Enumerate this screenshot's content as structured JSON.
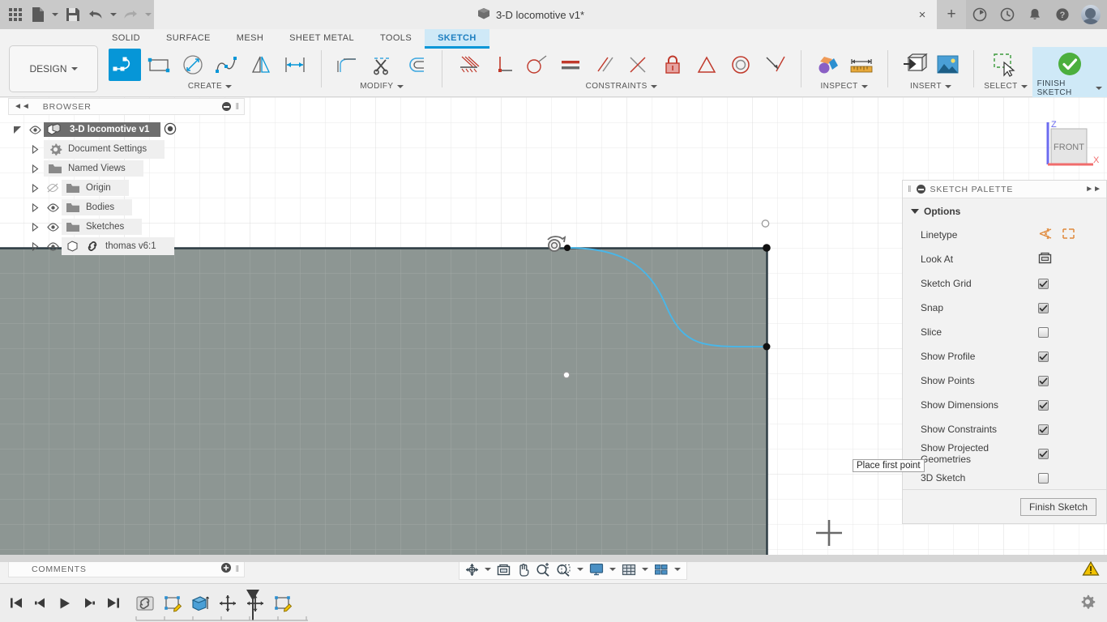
{
  "titlebar": {
    "app_grid_icon": "app-grid-icon",
    "new_label": "new-document-icon",
    "save_label": "save-icon",
    "undo_label": "undo-icon",
    "redo_label": "redo-icon",
    "document_title": "3-D locomotive v1*",
    "document_icon": "cube-icon",
    "close_label": "×",
    "plus_label": "+",
    "icons": [
      "job-status-icon",
      "recent-icon",
      "notifications-icon",
      "help-icon"
    ],
    "avatar": "user-avatar"
  },
  "ribbon": {
    "workspace_button": "DESIGN",
    "tabs": [
      {
        "label": "SOLID",
        "active": false
      },
      {
        "label": "SURFACE",
        "active": false
      },
      {
        "label": "MESH",
        "active": false
      },
      {
        "label": "SHEET METAL",
        "active": false
      },
      {
        "label": "TOOLS",
        "active": false
      },
      {
        "label": "SKETCH",
        "active": true
      }
    ],
    "panels": [
      {
        "label": "CREATE",
        "has_dropdown": true,
        "tools": [
          "line-tool",
          "rectangle-tool",
          "circle-tool",
          "spline-tool",
          "mirror-tool",
          "sketch-dimension-tool"
        ]
      },
      {
        "label": "MODIFY",
        "has_dropdown": true,
        "tools": [
          "fillet-tool",
          "trim-tool",
          "offset-tool"
        ]
      },
      {
        "label": "CONSTRAINTS",
        "has_dropdown": true,
        "tools": [
          "horizontal-vertical-constraint",
          "perpendicular-constraint",
          "tangent-constraint",
          "equal-constraint",
          "parallel-constraint",
          "coincident-constraint",
          "fix-unfix-constraint",
          "midpoint-constraint",
          "concentric-constraint",
          "collinear-constraint"
        ]
      },
      {
        "label": "INSPECT",
        "has_dropdown": true,
        "tools": [
          "interference-tool",
          "measure-tool"
        ]
      },
      {
        "label": "INSERT",
        "has_dropdown": true,
        "tools": [
          "insert-derive-tool",
          "insert-canvas-tool"
        ]
      },
      {
        "label": "SELECT",
        "has_dropdown": true,
        "tools": [
          "select-window-tool"
        ]
      },
      {
        "label": "FINISH SKETCH",
        "has_dropdown": true,
        "tools": [
          "finish-sketch-check"
        ]
      }
    ]
  },
  "browser": {
    "title": "BROWSER",
    "collapse_icon": "collapse-left-icon",
    "tree": [
      {
        "label": "3-D locomotive v1",
        "icon": "assembly-icon",
        "eye": true,
        "root": true,
        "expander": "open"
      },
      {
        "label": "Document Settings",
        "icon": "gear-icon",
        "eye": false,
        "expander": "closed"
      },
      {
        "label": "Named Views",
        "icon": "folder-icon",
        "eye": false,
        "expander": "closed"
      },
      {
        "label": "Origin",
        "icon": "folder-icon",
        "eye": "hidden",
        "expander": "closed"
      },
      {
        "label": "Bodies",
        "icon": "folder-icon",
        "eye": true,
        "expander": "closed"
      },
      {
        "label": "Sketches",
        "icon": "folder-icon",
        "eye": true,
        "expander": "closed"
      },
      {
        "label": "thomas v6:1",
        "icon": "component-linked-icon",
        "eye": true,
        "expander": "closed"
      }
    ]
  },
  "sketch_palette": {
    "title": "SKETCH PALETTE",
    "pin_icon": "collapse-right-icon",
    "section_label": "Options",
    "rows": [
      {
        "label": "Linetype",
        "type": "icons",
        "icons": [
          "construction-line-icon",
          "centerline-icon"
        ]
      },
      {
        "label": "Look At",
        "type": "icon",
        "icons": [
          "look-at-icon"
        ]
      },
      {
        "label": "Sketch Grid",
        "type": "checkbox",
        "checked": true
      },
      {
        "label": "Snap",
        "type": "checkbox",
        "checked": true
      },
      {
        "label": "Slice",
        "type": "checkbox",
        "checked": false
      },
      {
        "label": "Show Profile",
        "type": "checkbox",
        "checked": true
      },
      {
        "label": "Show Points",
        "type": "checkbox",
        "checked": true
      },
      {
        "label": "Show Dimensions",
        "type": "checkbox",
        "checked": true
      },
      {
        "label": "Show Constraints",
        "type": "checkbox",
        "checked": true
      },
      {
        "label": "Show Projected Geometries",
        "type": "checkbox",
        "checked": true
      },
      {
        "label": "3D Sketch",
        "type": "checkbox",
        "checked": false
      }
    ],
    "finish_button": "Finish Sketch"
  },
  "canvas": {
    "tooltip": "Place first point",
    "viewcube": {
      "face": "FRONT",
      "z_label": "Z",
      "x_label": "X"
    },
    "cursor": "crosshair-cursor",
    "sketch_elements": {
      "top_edge_line": "sketch-line-top",
      "right_edge_line": "sketch-line-right",
      "spline": "sketch-spline",
      "points": [
        "sketch-point-top-left",
        "sketch-point-top-right",
        "sketch-point-right-mid",
        "sketch-point-free-open",
        "sketch-point-open-top"
      ],
      "constraint_badge": "tangent-constraint-badge"
    },
    "grid_spacing_px": 31,
    "profile_fill_color": "#8d9693",
    "spline_color": "#49b6e8"
  },
  "comments": {
    "title": "COMMENTS",
    "add_icon": "add-comment-icon"
  },
  "navbar": {
    "items": [
      "orbit-icon",
      "look-at-icon",
      "pan-icon",
      "zoom-icon",
      "zoom-window-icon",
      "display-settings-icon",
      "grid-snap-icon",
      "viewports-icon"
    ]
  },
  "timeline": {
    "controls": [
      "jump-to-beginning",
      "step-back",
      "play",
      "step-forward",
      "jump-to-end"
    ],
    "items": [
      "link-feature",
      "sketch-edit-1",
      "extrude-feature",
      "move-feature-1",
      "move-feature-2",
      "sketch-edit-2"
    ],
    "marker": "timeline-marker",
    "settings_icon": "timeline-settings-gear"
  },
  "status": {
    "warning_icon": "warning-triangle-icon"
  },
  "colors": {
    "accent": "#0696d7",
    "tab_active_bg": "#cfe9f7",
    "profile_gray": "#8d9693",
    "spline_blue": "#49b6e8",
    "warning_yellow": "#f2c200",
    "check_green": "#4caf3e"
  }
}
